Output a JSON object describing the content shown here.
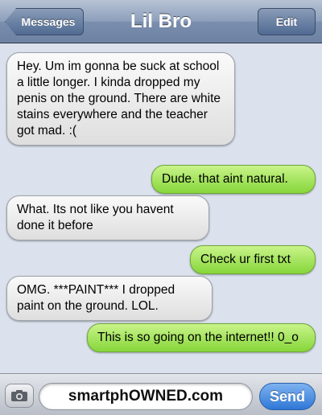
{
  "nav": {
    "back_label": "Messages",
    "title": "Lil Bro",
    "edit_label": "Edit"
  },
  "messages": [
    {
      "from": "contact",
      "text": "Hey. Um im gonna be suck at school a little longer. I kinda dropped my penis on the ground. There are white stains everywhere and the teacher got mad. :("
    },
    {
      "from": "me",
      "text": "Dude. that aint natural."
    },
    {
      "from": "contact",
      "text": "What. Its not like you havent done it before"
    },
    {
      "from": "me",
      "text": "Check ur first txt"
    },
    {
      "from": "contact",
      "text": "OMG. ***PAINT*** I dropped paint on the ground. LOL."
    },
    {
      "from": "me",
      "text": "This is so going on the internet!! 0_o"
    }
  ],
  "compose": {
    "camera_icon": "camera-icon",
    "input_value": "smartphOWNED.com",
    "send_label": "Send"
  },
  "colors": {
    "incoming_bubble": "#e6e6e6",
    "outgoing_bubble": "#9de35a",
    "send_button": "#2f77d6",
    "nav_bar": "#7a8eae"
  }
}
